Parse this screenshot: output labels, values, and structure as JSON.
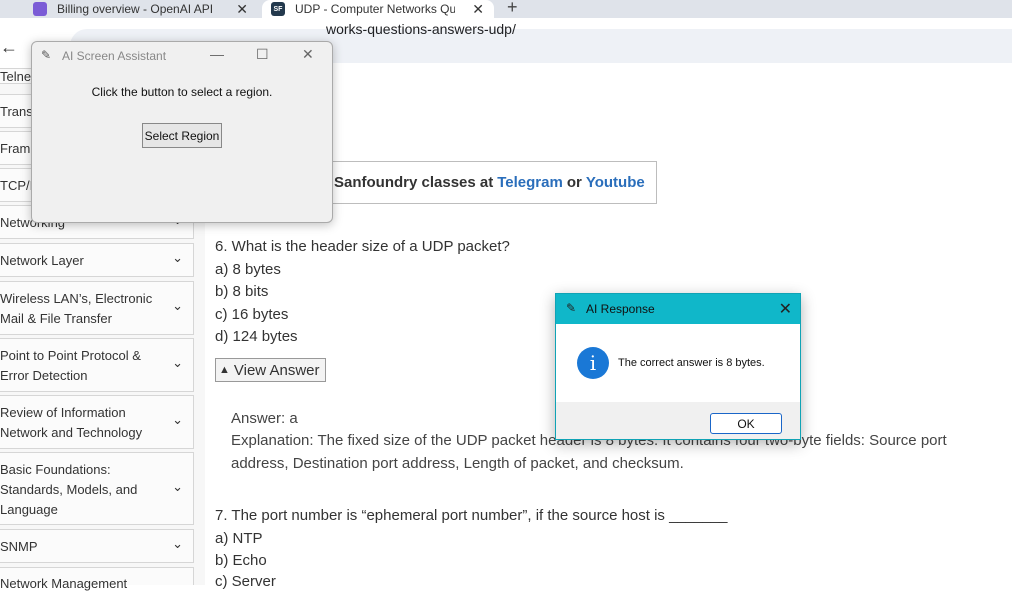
{
  "browser": {
    "tabs": [
      {
        "title": "Billing overview - OpenAI API",
        "close": "✕"
      },
      {
        "title": "UDP - Computer Networks Que",
        "close": "✕",
        "favicon": "SF"
      }
    ],
    "new_tab": "+",
    "back": "←",
    "url": "works-questions-answers-udp/"
  },
  "sidebar": {
    "items": [
      {
        "label": "Telne",
        "chevron": ""
      },
      {
        "label": "Trans",
        "chevron": ""
      },
      {
        "label": "Fram",
        "chevron": ""
      },
      {
        "label": "TCP/I",
        "chevron": ""
      },
      {
        "label": "Networking",
        "chevron": "⌄"
      },
      {
        "label": "Network Layer",
        "chevron": "⌄"
      },
      {
        "label": "Wireless LAN’s, Electronic Mail & File Transfer",
        "chevron": "⌄"
      },
      {
        "label": "Point to Point Protocol & Error Detection",
        "chevron": "⌄"
      },
      {
        "label": "Review of Information Network and Technology",
        "chevron": "⌄"
      },
      {
        "label": "Basic Foundations: Standards, Models, and Language",
        "chevron": "⌄"
      },
      {
        "label": "SNMP",
        "chevron": "⌄"
      },
      {
        "label": "Network Management",
        "chevron": ""
      }
    ]
  },
  "promo": {
    "prefix": "Sanfoundry classes at",
    "link1": "Telegram",
    "middle": "or",
    "link2": "Youtube"
  },
  "questions": {
    "q6": {
      "text": "6. What is the header size of a UDP packet?",
      "options": [
        "a) 8 bytes",
        "b) 8 bits",
        "c) 16 bytes",
        "d) 124 bytes"
      ]
    },
    "view_answer": "View Answer",
    "answer_line": "Answer: a",
    "explanation_1": "Explanation: The fixed size of the UDP packet header is 8 bytes. It contains four two-byte fields: Source port",
    "explanation_2": "address, Destination port address, Length of packet, and checksum.",
    "q7": {
      "text": "7. The port number is “ephemeral port number”, if the source host is _______",
      "options": [
        "a) NTP",
        "b) Echo",
        "c) Server"
      ]
    }
  },
  "assistant": {
    "title": "AI Screen Assistant",
    "message": "Click the button to select a region.",
    "button": "Select Region",
    "minimize": "—",
    "maximize": "☐",
    "close": "✕"
  },
  "response": {
    "title": "AI Response",
    "message": "The correct answer is 8 bytes.",
    "ok": "OK",
    "close": "✕",
    "icon": "info-icon"
  }
}
